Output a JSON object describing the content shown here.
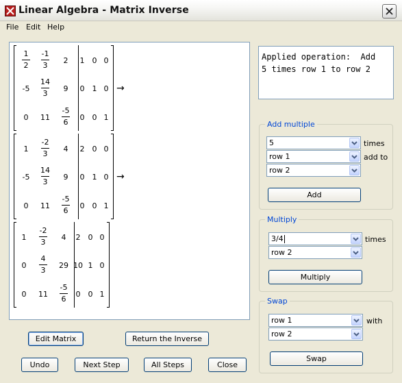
{
  "window": {
    "title": "Linear Algebra - Matrix Inverse"
  },
  "menu": {
    "items": [
      "File",
      "Edit",
      "Help"
    ]
  },
  "matrices": [
    {
      "rows": [
        [
          {
            "n": "1",
            "d": "2"
          },
          {
            "n": "-1",
            "d": "3"
          },
          "2",
          "1",
          "0",
          "0"
        ],
        [
          "-5",
          {
            "n": "14",
            "d": "3"
          },
          "9",
          "0",
          "1",
          "0"
        ],
        [
          "0",
          "11",
          {
            "n": "-5",
            "d": "6"
          },
          "0",
          "0",
          "1"
        ]
      ],
      "arrow": "→"
    },
    {
      "rows": [
        [
          "1",
          {
            "n": "-2",
            "d": "3"
          },
          "4",
          "2",
          "0",
          "0"
        ],
        [
          "-5",
          {
            "n": "14",
            "d": "3"
          },
          "9",
          "0",
          "1",
          "0"
        ],
        [
          "0",
          "11",
          {
            "n": "-5",
            "d": "6"
          },
          "0",
          "0",
          "1"
        ]
      ],
      "arrow": "→"
    },
    {
      "rows": [
        [
          "1",
          {
            "n": "-2",
            "d": "3"
          },
          "4",
          "2",
          "0",
          "0"
        ],
        [
          "0",
          {
            "n": "4",
            "d": "3"
          },
          "29",
          "10",
          "1",
          "0"
        ],
        [
          "0",
          "11",
          {
            "n": "-5",
            "d": "6"
          },
          "0",
          "0",
          "1"
        ]
      ],
      "arrow": ""
    }
  ],
  "operation_text": "Applied operation:  Add\n5 times row 1 to row 2",
  "add_multiple": {
    "title": "Add multiple",
    "factor": "5",
    "times_label": "times",
    "source_row": "row 1",
    "add_to_label": "add to",
    "target_row": "row 2",
    "button": "Add"
  },
  "multiply": {
    "title": "Multiply",
    "factor": "3/4",
    "times_label": "times",
    "row": "row 2",
    "button": "Multiply"
  },
  "swap": {
    "title": "Swap",
    "row_a": "row 1",
    "with_label": "with",
    "row_b": "row 2",
    "button": "Swap"
  },
  "buttons": {
    "edit_matrix": "Edit Matrix",
    "return_inverse": "Return the Inverse",
    "undo": "Undo",
    "next_step": "Next Step",
    "all_steps": "All Steps",
    "close": "Close"
  }
}
